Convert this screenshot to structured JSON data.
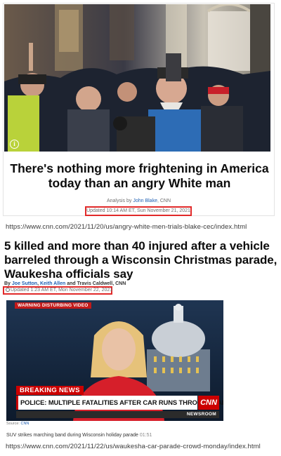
{
  "article1": {
    "headline": "There's nothing more frightening in America today than an angry White man",
    "byline_prefix": "Analysis by ",
    "byline_author": "John Blake",
    "byline_suffix": ", CNN",
    "updated": "Updated 10:14 AM ET, Sun November 21, 2021",
    "photo_info_icon": "info-icon",
    "url": "https://www.cnn.com/2021/11/20/us/angry-white-men-trials-blake-cec/index.html"
  },
  "article2": {
    "headline": "5 killed and more than 40 injured after a vehicle barreled through a Wisconsin Christmas parade, Waukesha officials say",
    "byline_by": "By ",
    "author1": "Joe Sutton",
    "sep1": ", ",
    "author2": "Keith Allen",
    "and": " and Travis Caldwell, CNN",
    "updated": "Updated 1:23 AM ET, Mon November 22, 2021",
    "video": {
      "warning": "WARNING DISTURBING VIDEO",
      "breaking": "BREAKING NEWS",
      "lower_third": "POLICE: MULTIPLE FATALITIES AFTER CAR RUNS THROUGH PARADE",
      "logo": "CNN",
      "newsroom": "NEWSROOM"
    },
    "source_prefix": "Source: ",
    "source_name": "CNN",
    "caption": "SUV strikes marching band during Wisconsin holiday parade",
    "duration": "01:51",
    "url": "https://www.cnn.com/2021/11/22/us/waukesha-car-parade-crowd-monday/index.html"
  },
  "colors": {
    "highlight_box": "#e12a2a",
    "cnn_red": "#cc0000",
    "link_blue": "#1e5fb3"
  }
}
